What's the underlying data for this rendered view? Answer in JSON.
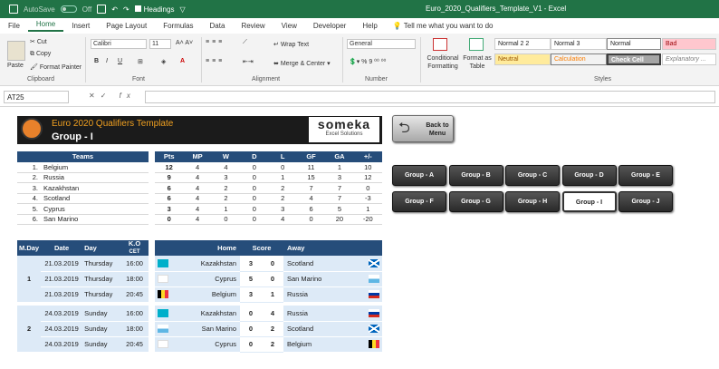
{
  "titlebar": {
    "autosave_label": "AutoSave",
    "autosave_state": "Off",
    "headings_label": "Headings",
    "window_title": "Euro_2020_Qualifiers_Template_V1  -  Excel"
  },
  "tabs": [
    "File",
    "Home",
    "Insert",
    "Page Layout",
    "Formulas",
    "Data",
    "Review",
    "View",
    "Developer",
    "Help"
  ],
  "tell_me": "Tell me what you want to do",
  "ribbon": {
    "clipboard": {
      "paste": "Paste",
      "cut": "Cut",
      "copy": "Copy",
      "format_painter": "Format Painter",
      "label": "Clipboard"
    },
    "font": {
      "name": "Calibri",
      "size": "11",
      "label": "Font"
    },
    "alignment": {
      "wrap": "Wrap Text",
      "merge": "Merge & Center",
      "label": "Alignment"
    },
    "number": {
      "format": "General",
      "label": "Number"
    },
    "styles": {
      "conditional": "Conditional Formatting",
      "format_as_table": "Format as Table",
      "cells": [
        "Normal 2 2",
        "Normal 3",
        "Normal",
        "Bad",
        "Neutral",
        "Calculation",
        "Check Cell",
        "Explanatory ..."
      ],
      "label": "Styles"
    }
  },
  "formula": {
    "name_box": "AT25",
    "fx": "fx",
    "content": ""
  },
  "sheet": {
    "banner_title": "Euro 2020 Qualifiers Template",
    "group_title": "Group - I",
    "logo_main": "someka",
    "logo_sub": "Excel Solutions",
    "back_label": "Back to Menu",
    "teams_header": "Teams",
    "stats_headers": [
      "Pts",
      "MP",
      "W",
      "D",
      "L",
      "GF",
      "GA",
      "+/-"
    ],
    "standings": [
      {
        "rank": "1.",
        "team": "Belgium",
        "stats": [
          "12",
          "4",
          "4",
          "0",
          "0",
          "11",
          "1",
          "10"
        ]
      },
      {
        "rank": "2.",
        "team": "Russia",
        "stats": [
          "9",
          "4",
          "3",
          "0",
          "1",
          "15",
          "3",
          "12"
        ]
      },
      {
        "rank": "3.",
        "team": "Kazakhstan",
        "stats": [
          "6",
          "4",
          "2",
          "0",
          "2",
          "7",
          "7",
          "0"
        ]
      },
      {
        "rank": "4.",
        "team": "Scotland",
        "stats": [
          "6",
          "4",
          "2",
          "0",
          "2",
          "4",
          "7",
          "-3"
        ]
      },
      {
        "rank": "5.",
        "team": "Cyprus",
        "stats": [
          "3",
          "4",
          "1",
          "0",
          "3",
          "6",
          "5",
          "1"
        ]
      },
      {
        "rank": "6.",
        "team": "San Marino",
        "stats": [
          "0",
          "4",
          "0",
          "0",
          "4",
          "0",
          "20",
          "-20"
        ]
      }
    ],
    "group_buttons": [
      "Group - A",
      "Group - B",
      "Group - C",
      "Group - D",
      "Group - E",
      "Group - F",
      "Group - G",
      "Group - H",
      "Group - I",
      "Group - J"
    ],
    "match_headers": {
      "mday": "M.Day",
      "date": "Date",
      "day": "Day",
      "ko": "K.O",
      "cet": "CET",
      "home": "Home",
      "score": "Score",
      "away": "Away"
    },
    "matchdays": [
      {
        "mday": "1",
        "matches": [
          {
            "date": "21.03.2019",
            "day": "Thursday",
            "ko": "16:00",
            "home": "Kazakhstan",
            "hs": "3",
            "as": "0",
            "away": "Scotland",
            "hflag": "kaz",
            "aflag": "sco"
          },
          {
            "date": "21.03.2019",
            "day": "Thursday",
            "ko": "18:00",
            "home": "Cyprus",
            "hs": "5",
            "as": "0",
            "away": "San Marino",
            "hflag": "cyp",
            "aflag": "smr"
          },
          {
            "date": "21.03.2019",
            "day": "Thursday",
            "ko": "20:45",
            "home": "Belgium",
            "hs": "3",
            "as": "1",
            "away": "Russia",
            "hflag": "bel",
            "aflag": "rus"
          }
        ]
      },
      {
        "mday": "2",
        "matches": [
          {
            "date": "24.03.2019",
            "day": "Sunday",
            "ko": "16:00",
            "home": "Kazakhstan",
            "hs": "0",
            "as": "4",
            "away": "Russia",
            "hflag": "kaz",
            "aflag": "rus"
          },
          {
            "date": "24.03.2019",
            "day": "Sunday",
            "ko": "18:00",
            "home": "San Marino",
            "hs": "0",
            "as": "2",
            "away": "Scotland",
            "hflag": "smr",
            "aflag": "sco"
          },
          {
            "date": "24.03.2019",
            "day": "Sunday",
            "ko": "20:45",
            "home": "Cyprus",
            "hs": "0",
            "as": "2",
            "away": "Belgium",
            "hflag": "cyp",
            "aflag": "bel"
          }
        ]
      }
    ]
  },
  "colors": {
    "excel_green": "#217346",
    "header_blue": "#264d7a",
    "row_blue": "#ddeaf7",
    "banner_orange": "#f0a020"
  }
}
